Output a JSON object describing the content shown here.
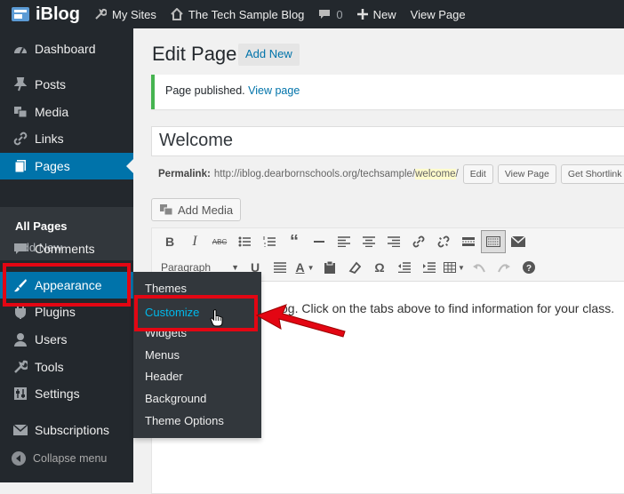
{
  "adminbar": {
    "site_logo": "iBlog",
    "my_sites": "My Sites",
    "site_name": "The Tech Sample Blog",
    "comments_count": "0",
    "new_label": "New",
    "view_page": "View Page"
  },
  "sidebar": {
    "dashboard": "Dashboard",
    "posts": "Posts",
    "media": "Media",
    "links": "Links",
    "pages": "Pages",
    "all_pages": "All Pages",
    "add_new": "Add New",
    "comments": "Comments",
    "appearance": "Appearance",
    "plugins": "Plugins",
    "users": "Users",
    "tools": "Tools",
    "settings": "Settings",
    "subscriptions": "Subscriptions",
    "collapse": "Collapse menu"
  },
  "appearance_submenu": {
    "themes": "Themes",
    "customize": "Customize",
    "widgets": "Widgets",
    "menus": "Menus",
    "header": "Header",
    "background": "Background",
    "theme_options": "Theme Options"
  },
  "main": {
    "title": "Edit Page",
    "add_new_button": "Add New",
    "notice_text": "Page published.",
    "notice_link": "View page",
    "post_title": "Welcome",
    "permalink_label": "Permalink:",
    "permalink_base": "http://iblog.dearbornschools.org/techsample/",
    "permalink_slug": "welcome",
    "permalink_end": "/",
    "edit_button": "Edit",
    "view_page_button": "View Page",
    "get_shortlink_button": "Get Shortlink",
    "add_media": "Add Media"
  },
  "editor": {
    "format_select": "Paragraph",
    "content_visible": "og.  Click on the tabs above to find information for your class."
  },
  "colors": {
    "accent": "#0073aa",
    "highlight_red": "#e30613",
    "notice_green": "#46b450"
  }
}
